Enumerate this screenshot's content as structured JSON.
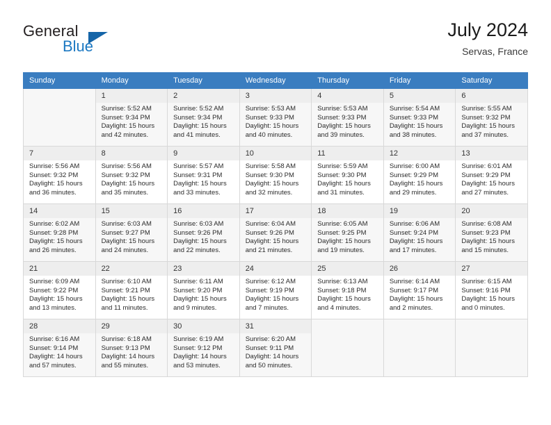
{
  "brand": {
    "name_part1": "General",
    "name_part2": "Blue",
    "logo_icon": "triangle-icon"
  },
  "header": {
    "title": "July 2024",
    "location": "Servas, France"
  },
  "weekdays": [
    "Sunday",
    "Monday",
    "Tuesday",
    "Wednesday",
    "Thursday",
    "Friday",
    "Saturday"
  ],
  "colors": {
    "header_blue": "#3a7dc0",
    "brand_blue": "#1b78c2",
    "daynum_bg": "#eeeeee",
    "row_shade": "#f7f7f7",
    "grid_border": "#d8d8d8"
  },
  "weeks": [
    [
      {
        "day": "",
        "lines": []
      },
      {
        "day": "1",
        "lines": [
          "Sunrise: 5:52 AM",
          "Sunset: 9:34 PM",
          "Daylight: 15 hours",
          "and 42 minutes."
        ]
      },
      {
        "day": "2",
        "lines": [
          "Sunrise: 5:52 AM",
          "Sunset: 9:34 PM",
          "Daylight: 15 hours",
          "and 41 minutes."
        ]
      },
      {
        "day": "3",
        "lines": [
          "Sunrise: 5:53 AM",
          "Sunset: 9:33 PM",
          "Daylight: 15 hours",
          "and 40 minutes."
        ]
      },
      {
        "day": "4",
        "lines": [
          "Sunrise: 5:53 AM",
          "Sunset: 9:33 PM",
          "Daylight: 15 hours",
          "and 39 minutes."
        ]
      },
      {
        "day": "5",
        "lines": [
          "Sunrise: 5:54 AM",
          "Sunset: 9:33 PM",
          "Daylight: 15 hours",
          "and 38 minutes."
        ]
      },
      {
        "day": "6",
        "lines": [
          "Sunrise: 5:55 AM",
          "Sunset: 9:32 PM",
          "Daylight: 15 hours",
          "and 37 minutes."
        ]
      }
    ],
    [
      {
        "day": "7",
        "lines": [
          "Sunrise: 5:56 AM",
          "Sunset: 9:32 PM",
          "Daylight: 15 hours",
          "and 36 minutes."
        ]
      },
      {
        "day": "8",
        "lines": [
          "Sunrise: 5:56 AM",
          "Sunset: 9:32 PM",
          "Daylight: 15 hours",
          "and 35 minutes."
        ]
      },
      {
        "day": "9",
        "lines": [
          "Sunrise: 5:57 AM",
          "Sunset: 9:31 PM",
          "Daylight: 15 hours",
          "and 33 minutes."
        ]
      },
      {
        "day": "10",
        "lines": [
          "Sunrise: 5:58 AM",
          "Sunset: 9:30 PM",
          "Daylight: 15 hours",
          "and 32 minutes."
        ]
      },
      {
        "day": "11",
        "lines": [
          "Sunrise: 5:59 AM",
          "Sunset: 9:30 PM",
          "Daylight: 15 hours",
          "and 31 minutes."
        ]
      },
      {
        "day": "12",
        "lines": [
          "Sunrise: 6:00 AM",
          "Sunset: 9:29 PM",
          "Daylight: 15 hours",
          "and 29 minutes."
        ]
      },
      {
        "day": "13",
        "lines": [
          "Sunrise: 6:01 AM",
          "Sunset: 9:29 PM",
          "Daylight: 15 hours",
          "and 27 minutes."
        ]
      }
    ],
    [
      {
        "day": "14",
        "lines": [
          "Sunrise: 6:02 AM",
          "Sunset: 9:28 PM",
          "Daylight: 15 hours",
          "and 26 minutes."
        ]
      },
      {
        "day": "15",
        "lines": [
          "Sunrise: 6:03 AM",
          "Sunset: 9:27 PM",
          "Daylight: 15 hours",
          "and 24 minutes."
        ]
      },
      {
        "day": "16",
        "lines": [
          "Sunrise: 6:03 AM",
          "Sunset: 9:26 PM",
          "Daylight: 15 hours",
          "and 22 minutes."
        ]
      },
      {
        "day": "17",
        "lines": [
          "Sunrise: 6:04 AM",
          "Sunset: 9:26 PM",
          "Daylight: 15 hours",
          "and 21 minutes."
        ]
      },
      {
        "day": "18",
        "lines": [
          "Sunrise: 6:05 AM",
          "Sunset: 9:25 PM",
          "Daylight: 15 hours",
          "and 19 minutes."
        ]
      },
      {
        "day": "19",
        "lines": [
          "Sunrise: 6:06 AM",
          "Sunset: 9:24 PM",
          "Daylight: 15 hours",
          "and 17 minutes."
        ]
      },
      {
        "day": "20",
        "lines": [
          "Sunrise: 6:08 AM",
          "Sunset: 9:23 PM",
          "Daylight: 15 hours",
          "and 15 minutes."
        ]
      }
    ],
    [
      {
        "day": "21",
        "lines": [
          "Sunrise: 6:09 AM",
          "Sunset: 9:22 PM",
          "Daylight: 15 hours",
          "and 13 minutes."
        ]
      },
      {
        "day": "22",
        "lines": [
          "Sunrise: 6:10 AM",
          "Sunset: 9:21 PM",
          "Daylight: 15 hours",
          "and 11 minutes."
        ]
      },
      {
        "day": "23",
        "lines": [
          "Sunrise: 6:11 AM",
          "Sunset: 9:20 PM",
          "Daylight: 15 hours",
          "and 9 minutes."
        ]
      },
      {
        "day": "24",
        "lines": [
          "Sunrise: 6:12 AM",
          "Sunset: 9:19 PM",
          "Daylight: 15 hours",
          "and 7 minutes."
        ]
      },
      {
        "day": "25",
        "lines": [
          "Sunrise: 6:13 AM",
          "Sunset: 9:18 PM",
          "Daylight: 15 hours",
          "and 4 minutes."
        ]
      },
      {
        "day": "26",
        "lines": [
          "Sunrise: 6:14 AM",
          "Sunset: 9:17 PM",
          "Daylight: 15 hours",
          "and 2 minutes."
        ]
      },
      {
        "day": "27",
        "lines": [
          "Sunrise: 6:15 AM",
          "Sunset: 9:16 PM",
          "Daylight: 15 hours",
          "and 0 minutes."
        ]
      }
    ],
    [
      {
        "day": "28",
        "lines": [
          "Sunrise: 6:16 AM",
          "Sunset: 9:14 PM",
          "Daylight: 14 hours",
          "and 57 minutes."
        ]
      },
      {
        "day": "29",
        "lines": [
          "Sunrise: 6:18 AM",
          "Sunset: 9:13 PM",
          "Daylight: 14 hours",
          "and 55 minutes."
        ]
      },
      {
        "day": "30",
        "lines": [
          "Sunrise: 6:19 AM",
          "Sunset: 9:12 PM",
          "Daylight: 14 hours",
          "and 53 minutes."
        ]
      },
      {
        "day": "31",
        "lines": [
          "Sunrise: 6:20 AM",
          "Sunset: 9:11 PM",
          "Daylight: 14 hours",
          "and 50 minutes."
        ]
      },
      {
        "day": "",
        "lines": []
      },
      {
        "day": "",
        "lines": []
      },
      {
        "day": "",
        "lines": []
      }
    ]
  ]
}
